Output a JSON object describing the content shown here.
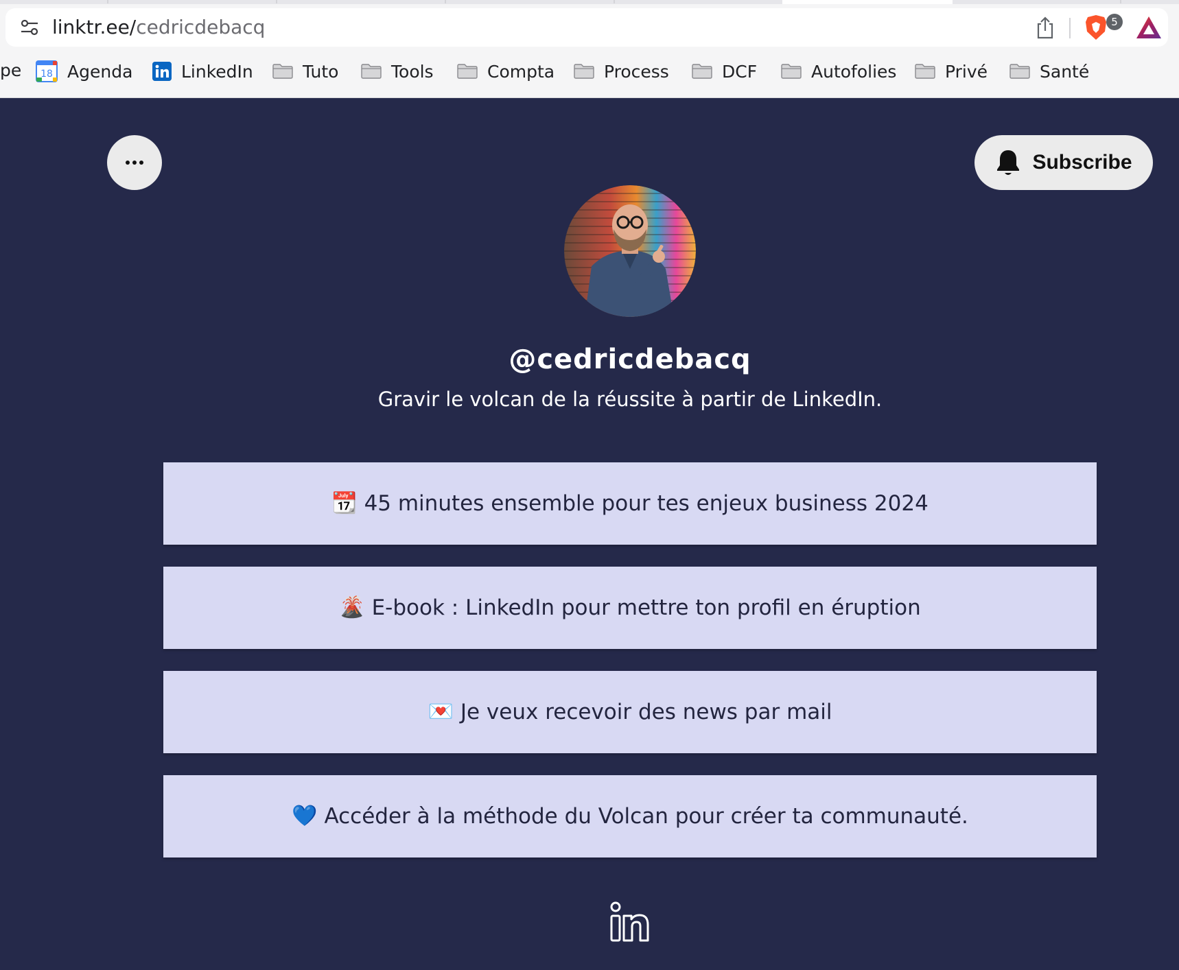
{
  "browser": {
    "url_host": "linktr.ee/",
    "url_path": "cedricdebacq",
    "shields_badge": "5",
    "bookmarks": {
      "partial_label": "pe",
      "items": [
        {
          "label": "Agenda",
          "icon": "calendar-icon",
          "icon_text": "18"
        },
        {
          "label": "LinkedIn",
          "icon": "linkedin-icon"
        },
        {
          "label": "Tuto",
          "icon": "folder-icon"
        },
        {
          "label": "Tools",
          "icon": "folder-icon"
        },
        {
          "label": "Compta",
          "icon": "folder-icon"
        },
        {
          "label": "Process",
          "icon": "folder-icon"
        },
        {
          "label": "DCF",
          "icon": "folder-icon"
        },
        {
          "label": "Autofolies",
          "icon": "folder-icon"
        },
        {
          "label": "Privé",
          "icon": "folder-icon"
        },
        {
          "label": "Santé",
          "icon": "folder-icon"
        }
      ]
    }
  },
  "profile": {
    "more_label": "···",
    "subscribe_label": "Subscribe",
    "handle": "@cedricdebacq",
    "bio": "Gravir le volcan de la réussite à partir de LinkedIn.",
    "links": [
      {
        "emoji": "📆",
        "label": "45 minutes ensemble pour tes enjeux business 2024"
      },
      {
        "emoji": "🌋",
        "label": "E-book : LinkedIn pour mettre ton profil en éruption"
      },
      {
        "emoji": "💌",
        "label": "Je veux recevoir des news par mail"
      },
      {
        "emoji": "💙",
        "label": "Accéder à la méthode du Volcan pour créer ta communauté."
      }
    ],
    "social_icons": [
      "linkedin-icon"
    ]
  },
  "colors": {
    "page_background": "#25294a",
    "link_background": "#d8d9f3",
    "link_text": "#23253f",
    "button_background": "#ebebeb"
  }
}
